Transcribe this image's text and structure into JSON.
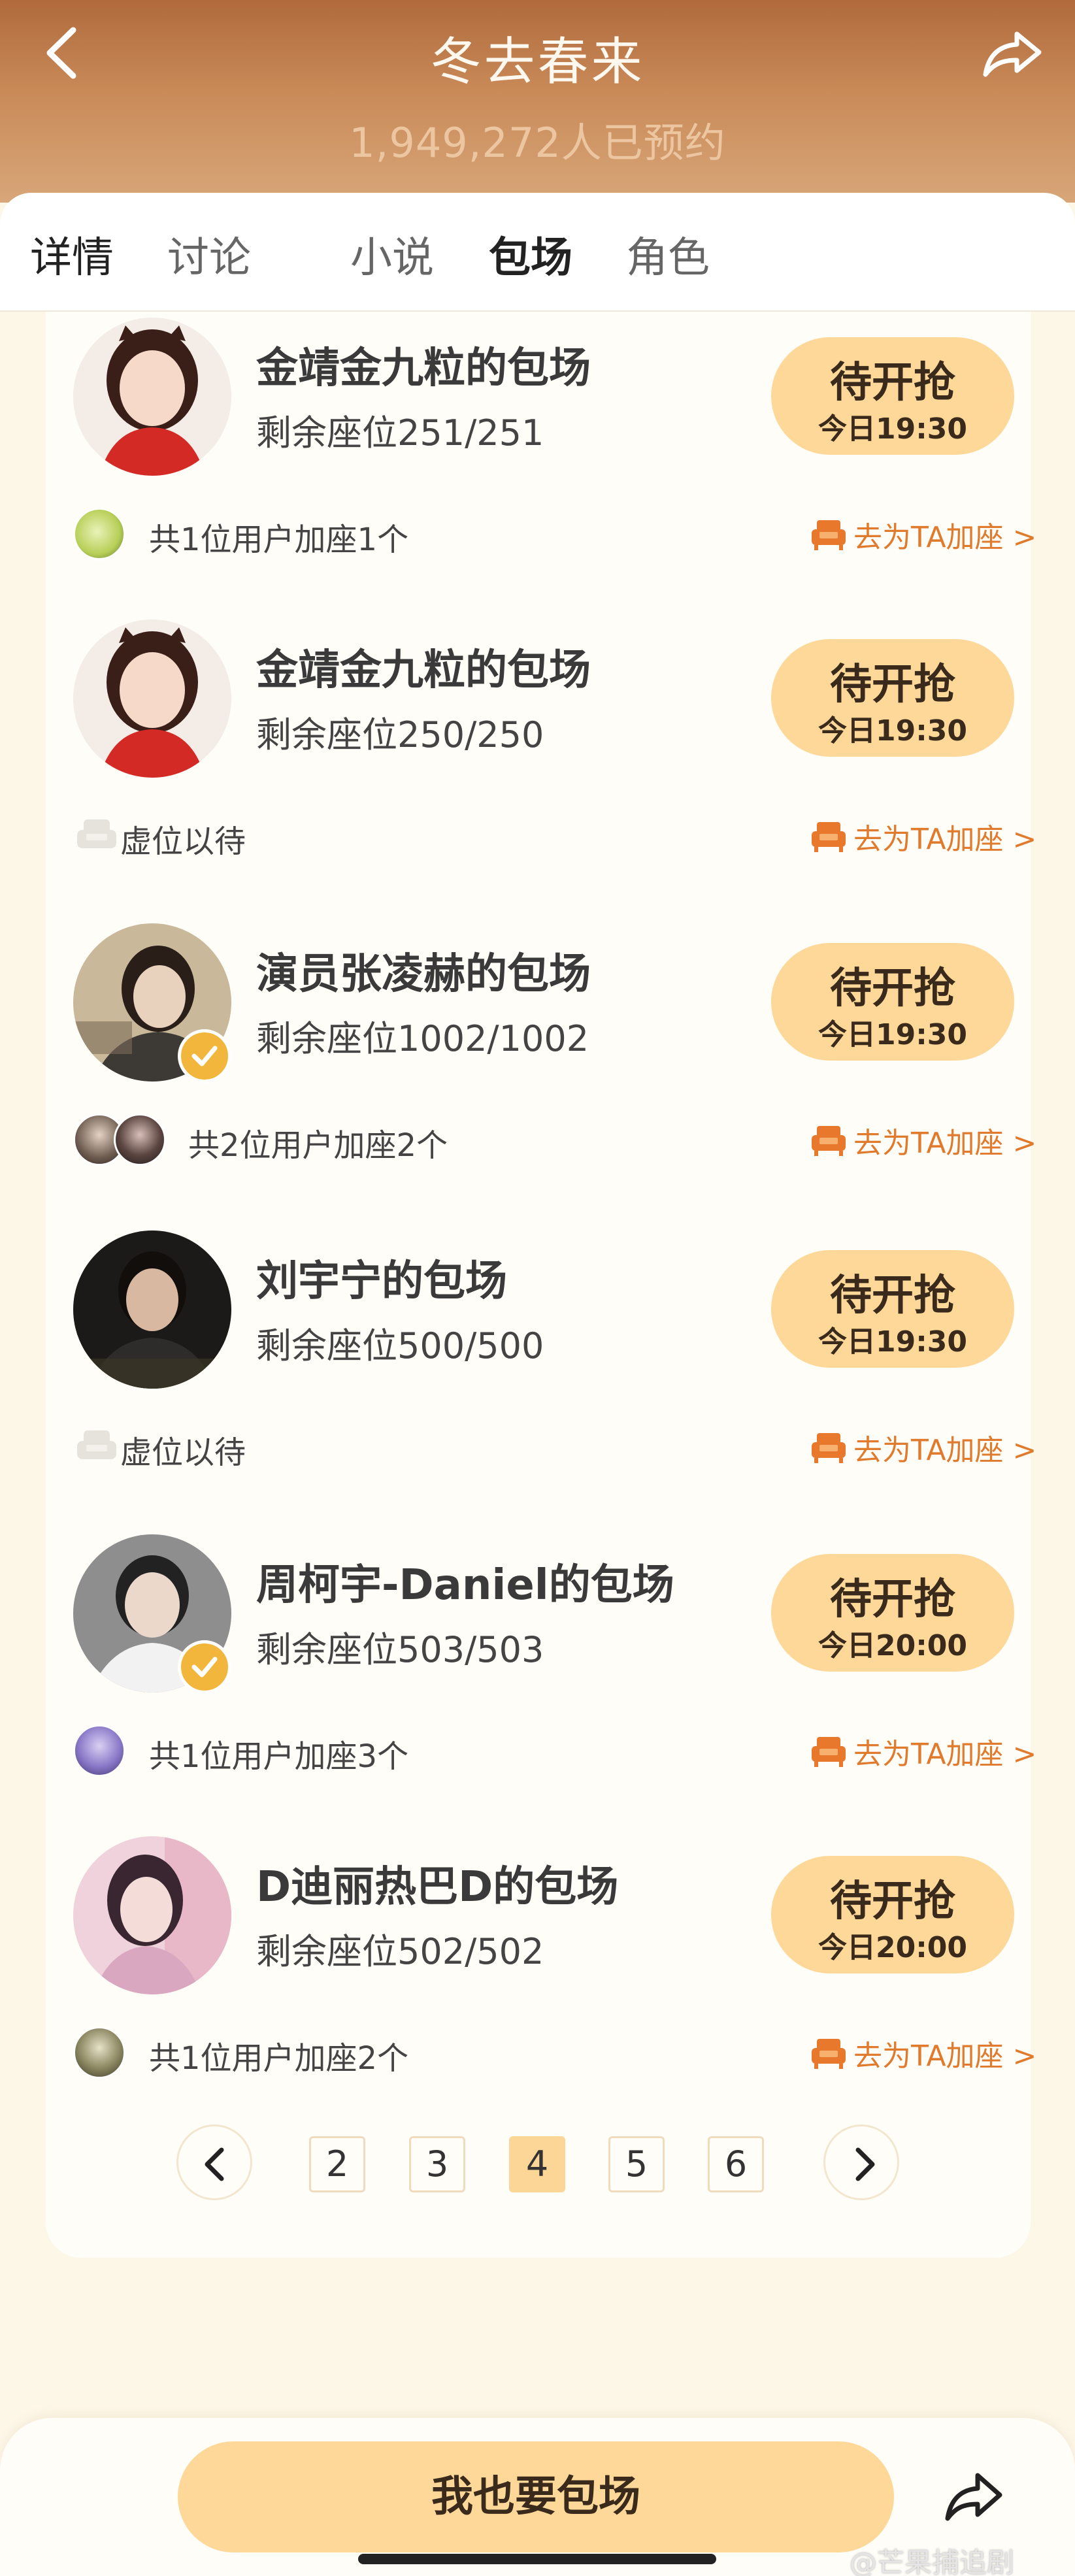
{
  "header": {
    "title": "冬去春来",
    "reserve_count": "1,949,272人已预约"
  },
  "tabs": [
    "详情",
    "讨论",
    "小说",
    "包场",
    "角色"
  ],
  "active_tab": "包场",
  "entries": [
    {
      "host": "金靖金九粒的包场",
      "seats": "剩余座位251/251",
      "button": "待开抢",
      "time": "今日19:30",
      "verified": false,
      "social": "共1位用户加座1个",
      "social_type": "users",
      "join": "去为TA加座 >"
    },
    {
      "host": "金靖金九粒的包场",
      "seats": "剩余座位250/250",
      "button": "待开抢",
      "time": "今日19:30",
      "verified": false,
      "social": "虚位以待",
      "social_type": "empty",
      "join": "去为TA加座 >"
    },
    {
      "host": "演员张凌赫的包场",
      "seats": "剩余座位1002/1002",
      "button": "待开抢",
      "time": "今日19:30",
      "verified": true,
      "social": "共2位用户加座2个",
      "social_type": "users2",
      "join": "去为TA加座 >"
    },
    {
      "host": "刘宇宁的包场",
      "seats": "剩余座位500/500",
      "button": "待开抢",
      "time": "今日19:30",
      "verified": false,
      "social": "虚位以待",
      "social_type": "empty",
      "join": "去为TA加座 >"
    },
    {
      "host": "周柯宇-Daniel的包场",
      "seats": "剩余座位503/503",
      "button": "待开抢",
      "time": "今日20:00",
      "verified": true,
      "social": "共1位用户加座3个",
      "social_type": "users",
      "join": "去为TA加座 >"
    },
    {
      "host": "D迪丽热巴D的包场",
      "seats": "剩余座位502/502",
      "button": "待开抢",
      "time": "今日20:00",
      "verified": false,
      "social": "共1位用户加座2个",
      "social_type": "users",
      "join": "去为TA加座 >"
    }
  ],
  "pagination": {
    "pages": [
      "2",
      "3",
      "4",
      "5",
      "6"
    ],
    "current": "4"
  },
  "bottom": {
    "cta": "我也要包场",
    "watermark": "@芒果捕追剧"
  },
  "colors": {
    "accent": "#fdd898",
    "link": "#e07a2c",
    "header": "#c98a58"
  }
}
